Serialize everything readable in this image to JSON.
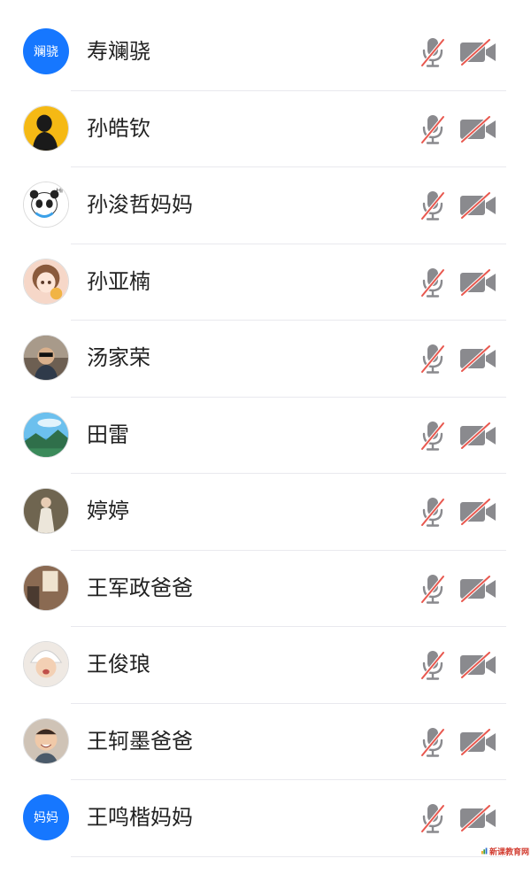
{
  "participants": [
    {
      "name": "寿斓骁",
      "avatar_type": "text",
      "avatar_text": "斓骁",
      "avatar_color": "#1677ff",
      "mic": "muted",
      "camera": "off"
    },
    {
      "name": "孙皓钦",
      "avatar_type": "image",
      "avatar_desc": "silhouette-on-yellow",
      "avatar_color": "#f5b914",
      "mic": "muted",
      "camera": "off"
    },
    {
      "name": "孙浚哲妈妈",
      "avatar_type": "image",
      "avatar_desc": "panda-mascot",
      "avatar_color": "#ffffff",
      "mic": "muted",
      "camera": "off"
    },
    {
      "name": "孙亚楠",
      "avatar_type": "image",
      "avatar_desc": "cartoon-girl",
      "avatar_color": "#f6d7c8",
      "mic": "muted",
      "camera": "off"
    },
    {
      "name": "汤家荣",
      "avatar_type": "image",
      "avatar_desc": "child-photo",
      "avatar_color": "#6d5f52",
      "mic": "muted",
      "camera": "off"
    },
    {
      "name": "田雷",
      "avatar_type": "image",
      "avatar_desc": "landscape-photo",
      "avatar_color": "#4aa8e0",
      "mic": "muted",
      "camera": "off"
    },
    {
      "name": "婷婷",
      "avatar_type": "image",
      "avatar_desc": "woman-photo",
      "avatar_color": "#8c7f66",
      "mic": "muted",
      "camera": "off"
    },
    {
      "name": "王军政爸爸",
      "avatar_type": "image",
      "avatar_desc": "indoor-photo",
      "avatar_color": "#7a5c4a",
      "mic": "muted",
      "camera": "off"
    },
    {
      "name": "王俊琅",
      "avatar_type": "image",
      "avatar_desc": "baby-photo",
      "avatar_color": "#e9e2dc",
      "mic": "muted",
      "camera": "off"
    },
    {
      "name": "王轲墨爸爸",
      "avatar_type": "image",
      "avatar_desc": "child-smiling-photo",
      "avatar_color": "#d9c8b8",
      "mic": "muted",
      "camera": "off"
    },
    {
      "name": "王鸣楷妈妈",
      "avatar_type": "text",
      "avatar_text": "妈妈",
      "avatar_color": "#1677ff",
      "mic": "muted",
      "camera": "off"
    }
  ],
  "icons": {
    "mic": "microphone-muted-icon",
    "camera": "camera-off-icon",
    "icon_gray": "#8a8a8e",
    "slash_red": "#e8584f"
  },
  "watermark": {
    "text": "新课教育网"
  }
}
